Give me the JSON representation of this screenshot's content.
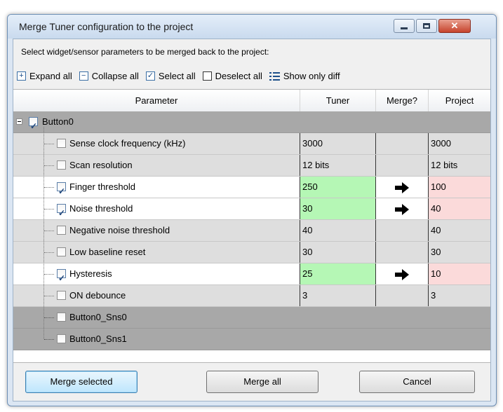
{
  "window": {
    "title": "Merge Tuner configuration to the project"
  },
  "instruction": "Select widget/sensor parameters to be merged back to the project:",
  "toolbar": {
    "expand_all": "Expand all",
    "collapse_all": "Collapse all",
    "select_all": "Select all",
    "deselect_all": "Deselect all",
    "show_only_diff": "Show only diff"
  },
  "columns": {
    "parameter": "Parameter",
    "tuner": "Tuner",
    "merge": "Merge?",
    "project": "Project"
  },
  "widget": {
    "name": "Button0",
    "checked": true
  },
  "rows": [
    {
      "parameter": "Sense clock frequency (kHz)",
      "tuner": "3000",
      "project": "3000",
      "checked": false,
      "diff": false
    },
    {
      "parameter": "Scan resolution",
      "tuner": "12 bits",
      "project": "12 bits",
      "checked": false,
      "diff": false
    },
    {
      "parameter": "Finger threshold",
      "tuner": "250",
      "project": "100",
      "checked": true,
      "diff": true
    },
    {
      "parameter": "Noise threshold",
      "tuner": "30",
      "project": "40",
      "checked": true,
      "diff": true
    },
    {
      "parameter": "Negative noise threshold",
      "tuner": "40",
      "project": "40",
      "checked": false,
      "diff": false
    },
    {
      "parameter": "Low baseline reset",
      "tuner": "30",
      "project": "30",
      "checked": false,
      "diff": false
    },
    {
      "parameter": "Hysteresis",
      "tuner": "25",
      "project": "10",
      "checked": true,
      "diff": true
    },
    {
      "parameter": "ON debounce",
      "tuner": "3",
      "project": "3",
      "checked": false,
      "diff": false
    }
  ],
  "sensors": [
    {
      "name": "Button0_Sns0"
    },
    {
      "name": "Button0_Sns1"
    }
  ],
  "buttons": {
    "merge_selected": "Merge selected",
    "merge_all": "Merge all",
    "cancel": "Cancel"
  },
  "colors": {
    "tuner_diff": "#b5f7b5",
    "project_diff": "#fbdada",
    "widget_row": "#a8a8a8"
  }
}
